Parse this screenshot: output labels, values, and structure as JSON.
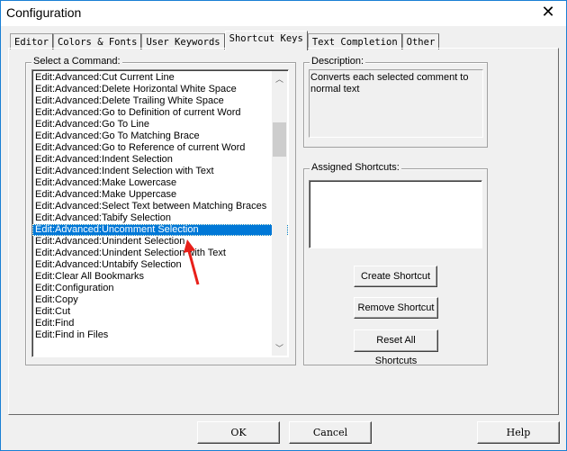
{
  "window": {
    "title": "Configuration",
    "close_icon": "close-icon"
  },
  "tabs": [
    {
      "label": "Editor"
    },
    {
      "label": "Colors & Fonts"
    },
    {
      "label": "User Keywords"
    },
    {
      "label": "Shortcut Keys",
      "active": true
    },
    {
      "label": "Text Completion"
    },
    {
      "label": "Other"
    }
  ],
  "commands": {
    "label": "Select a Command:",
    "items": [
      "Edit:Advanced:Cut Current Line",
      "Edit:Advanced:Delete Horizontal White Space",
      "Edit:Advanced:Delete Trailing White Space",
      "Edit:Advanced:Go to Definition of current Word",
      "Edit:Advanced:Go To Line",
      "Edit:Advanced:Go To Matching Brace",
      "Edit:Advanced:Go to Reference of current Word",
      "Edit:Advanced:Indent Selection",
      "Edit:Advanced:Indent Selection with Text",
      "Edit:Advanced:Make Lowercase",
      "Edit:Advanced:Make Uppercase",
      "Edit:Advanced:Select Text between Matching Braces",
      "Edit:Advanced:Tabify Selection",
      "Edit:Advanced:Uncomment Selection",
      "Edit:Advanced:Unindent Selection",
      "Edit:Advanced:Unindent Selection with Text",
      "Edit:Advanced:Untabify Selection",
      "Edit:Clear All Bookmarks",
      "Edit:Configuration",
      "Edit:Copy",
      "Edit:Cut",
      "Edit:Find",
      "Edit:Find in Files"
    ],
    "selected": "Edit:Advanced:Uncomment Selection",
    "selection_color": "#0078d7"
  },
  "description": {
    "label": "Description:",
    "text": "Converts each selected comment to normal text"
  },
  "shortcuts": {
    "label": "Assigned Shortcuts:",
    "create": "Create Shortcut",
    "remove": "Remove Shortcut",
    "reset": "Reset All Shortcuts"
  },
  "footer": {
    "ok": "OK",
    "cancel": "Cancel",
    "help": "Help"
  },
  "annotation": {
    "color": "#e8201a"
  }
}
